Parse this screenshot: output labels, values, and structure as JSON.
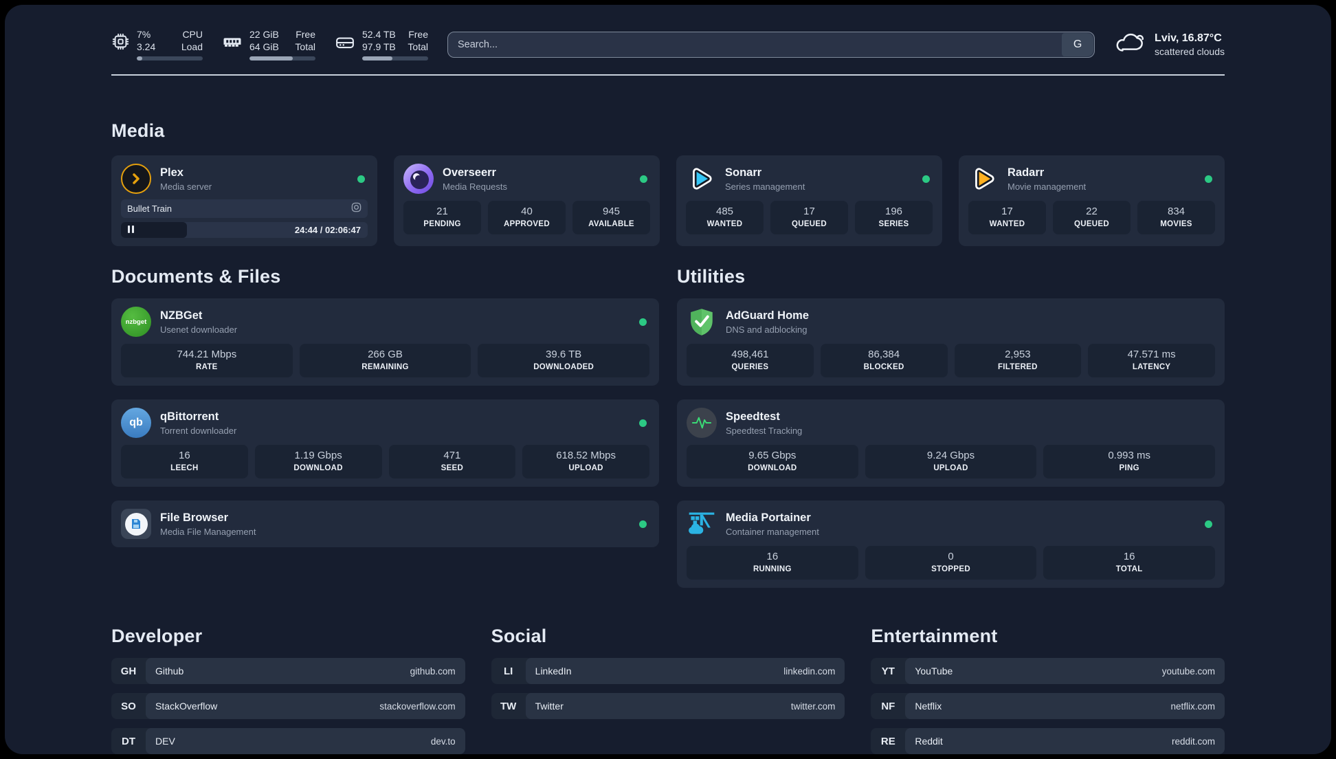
{
  "header": {
    "resources": [
      {
        "icon": "cpu-icon",
        "row1_value": "7%",
        "row1_label": "CPU",
        "row2_value": "3.24",
        "row2_label": "Load",
        "progress": 8
      },
      {
        "icon": "ram-icon",
        "row1_value": "22 GiB",
        "row1_label": "Free",
        "row2_value": "64 GiB",
        "row2_label": "Total",
        "progress": 66
      },
      {
        "icon": "disk-icon",
        "row1_value": "52.4 TB",
        "row1_label": "Free",
        "row2_value": "97.9 TB",
        "row2_label": "Total",
        "progress": 46
      }
    ],
    "search": {
      "placeholder": "Search...",
      "provider_label": "G"
    },
    "weather": {
      "icon": "scattered-clouds-icon",
      "location": "Lviv, 16.87°C",
      "condition": "scattered clouds"
    }
  },
  "sections": {
    "media": {
      "title": "Media",
      "cards": [
        {
          "name": "Plex",
          "desc": "Media server",
          "online": true,
          "player": {
            "title": "Bullet Train",
            "time": "24:44 / 02:06:47",
            "state": "paused"
          }
        },
        {
          "name": "Overseerr",
          "desc": "Media Requests",
          "online": true,
          "stats": [
            {
              "value": "21",
              "label": "PENDING"
            },
            {
              "value": "40",
              "label": "APPROVED"
            },
            {
              "value": "945",
              "label": "AVAILABLE"
            }
          ]
        },
        {
          "name": "Sonarr",
          "desc": "Series management",
          "online": true,
          "stats": [
            {
              "value": "485",
              "label": "WANTED"
            },
            {
              "value": "17",
              "label": "QUEUED"
            },
            {
              "value": "196",
              "label": "SERIES"
            }
          ]
        },
        {
          "name": "Radarr",
          "desc": "Movie management",
          "online": true,
          "stats": [
            {
              "value": "17",
              "label": "WANTED"
            },
            {
              "value": "22",
              "label": "QUEUED"
            },
            {
              "value": "834",
              "label": "MOVIES"
            }
          ]
        }
      ]
    },
    "documents": {
      "title": "Documents & Files",
      "cards": [
        {
          "name": "NZBGet",
          "desc": "Usenet downloader",
          "online": true,
          "icon_label": "nzbget",
          "stats": [
            {
              "value": "744.21 Mbps",
              "label": "RATE"
            },
            {
              "value": "266 GB",
              "label": "REMAINING"
            },
            {
              "value": "39.6 TB",
              "label": "DOWNLOADED"
            }
          ]
        },
        {
          "name": "qBittorrent",
          "desc": "Torrent downloader",
          "online": true,
          "icon_label": "qb",
          "stats": [
            {
              "value": "16",
              "label": "LEECH"
            },
            {
              "value": "1.19 Gbps",
              "label": "DOWNLOAD"
            },
            {
              "value": "471",
              "label": "SEED"
            },
            {
              "value": "618.52 Mbps",
              "label": "UPLOAD"
            }
          ]
        },
        {
          "name": "File Browser",
          "desc": "Media File Management",
          "online": true,
          "stats": []
        }
      ]
    },
    "utilities": {
      "title": "Utilities",
      "cards": [
        {
          "name": "AdGuard Home",
          "desc": "DNS and adblocking",
          "online": false,
          "stats": [
            {
              "value": "498,461",
              "label": "QUERIES"
            },
            {
              "value": "86,384",
              "label": "BLOCKED"
            },
            {
              "value": "2,953",
              "label": "FILTERED"
            },
            {
              "value": "47.571 ms",
              "label": "LATENCY"
            }
          ]
        },
        {
          "name": "Speedtest",
          "desc": "Speedtest Tracking",
          "online": false,
          "stats": [
            {
              "value": "9.65 Gbps",
              "label": "DOWNLOAD"
            },
            {
              "value": "9.24 Gbps",
              "label": "UPLOAD"
            },
            {
              "value": "0.993 ms",
              "label": "PING"
            }
          ]
        },
        {
          "name": "Media Portainer",
          "desc": "Container management",
          "online": true,
          "stats": [
            {
              "value": "16",
              "label": "RUNNING"
            },
            {
              "value": "0",
              "label": "STOPPED"
            },
            {
              "value": "16",
              "label": "TOTAL"
            }
          ]
        }
      ]
    },
    "developer": {
      "title": "Developer",
      "links": [
        {
          "abbr": "GH",
          "name": "Github",
          "url": "github.com"
        },
        {
          "abbr": "SO",
          "name": "StackOverflow",
          "url": "stackoverflow.com"
        },
        {
          "abbr": "DT",
          "name": "DEV",
          "url": "dev.to"
        }
      ]
    },
    "social": {
      "title": "Social",
      "links": [
        {
          "abbr": "LI",
          "name": "LinkedIn",
          "url": "linkedin.com"
        },
        {
          "abbr": "TW",
          "name": "Twitter",
          "url": "twitter.com"
        }
      ]
    },
    "entertainment": {
      "title": "Entertainment",
      "links": [
        {
          "abbr": "YT",
          "name": "YouTube",
          "url": "youtube.com"
        },
        {
          "abbr": "NF",
          "name": "Netflix",
          "url": "netflix.com"
        },
        {
          "abbr": "RE",
          "name": "Reddit",
          "url": "reddit.com"
        }
      ]
    }
  },
  "colors": {
    "status_online": "#2CC984",
    "plex_gold": "#E5A00D",
    "sonarr_blue": "#35C5F4",
    "radarr_orange": "#FFB020",
    "adguard_green": "#5FC36A",
    "speedtest_pulse": "#3ADB76",
    "portainer_blue": "#2BB3E3",
    "card_bg": "#222B3D",
    "page_bg": "#161D2E"
  }
}
